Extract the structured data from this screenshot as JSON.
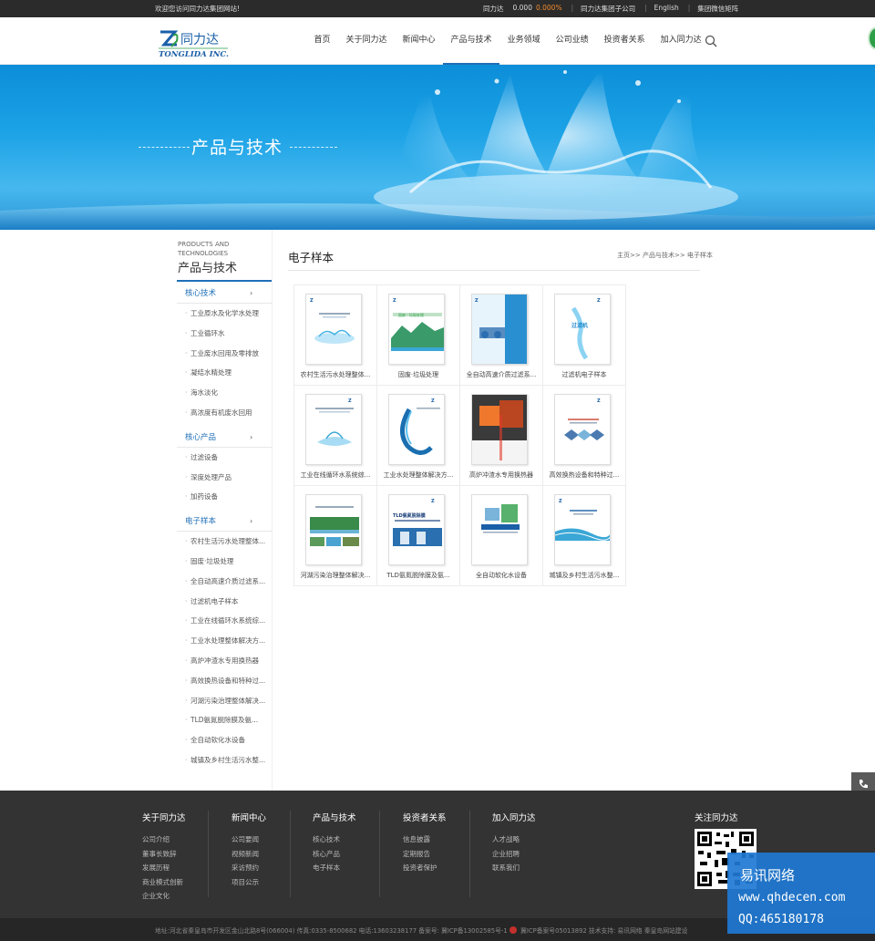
{
  "topbar": {
    "welcome": "欢迎您访问同力达集团网站!",
    "stock_name": "同力达",
    "stock_value": "0.000",
    "stock_change": "0.000%",
    "subsidiaries": "同力达集团子公司",
    "english": "English",
    "wechat": "集团微信矩阵"
  },
  "header": {
    "logo_text": "同力达",
    "logo_sub": "TONGLIDA INC.",
    "nav": [
      "首页",
      "关于同力达",
      "新闻中心",
      "产品与技术",
      "业务领域",
      "公司业绩",
      "投资者关系",
      "加入同力达"
    ],
    "active_nav": "产品与技术"
  },
  "banner": {
    "title": "产品与技术"
  },
  "sidebar": {
    "title_en": "PRODUCTS AND TECHNOLOGIES",
    "title_cn": "产品与技术",
    "categories": [
      {
        "label": "核心技术",
        "items": [
          "工业原水及化学水处理",
          "工业循环水",
          "工业废水回用及零排放",
          "凝结水精处理",
          "海水淡化",
          "高浓度有机废水回用"
        ]
      },
      {
        "label": "核心产品",
        "items": [
          "过滤设备",
          "深度处理产品",
          "加药设备"
        ]
      },
      {
        "label": "电子样本",
        "items": [
          "农村生活污水处理整体...",
          "固废·垃圾处理",
          "全自动高速介质过滤系...",
          "过滤机电子样本",
          "工业在线循环水系统综...",
          "工业水处理整体解决方...",
          "高炉冲渣水专用换热器",
          "高效换热设备和特种过...",
          "河湖污染治理整体解决...",
          "TLD氨氮脱除膜及氨...",
          "全自动软化水设备",
          "城镇及乡村生活污水整..."
        ]
      }
    ],
    "arrow": "›"
  },
  "main": {
    "title": "电子样本",
    "breadcrumb": "主页>> 产品与技术>> 电子样本",
    "cards": [
      "农村生活污水处理整体...",
      "固废·垃圾处理",
      "全自动高速介质过滤系...",
      "过滤机电子样本",
      "工业在线循环水系统综...",
      "工业水处理整体解决方...",
      "高炉冲渣水专用换热器",
      "高效换热设备和特种过...",
      "河湖污染治理整体解决...",
      "TLD氨氮脱除膜及氨...",
      "全自动软化水设备",
      "城镇及乡村生活污水整..."
    ],
    "cover_texts": [
      "",
      "固废 · 垃圾处理",
      "",
      "过滤机",
      "",
      "",
      "",
      "",
      "",
      "TLD氨氮脱除膜",
      "",
      ""
    ]
  },
  "footer": {
    "columns": [
      {
        "title": "关于同力达",
        "items": [
          "公司介绍",
          "董事长致辞",
          "发展历程",
          "商业模式创新",
          "企业文化"
        ]
      },
      {
        "title": "新闻中心",
        "items": [
          "公司要闻",
          "视频新闻",
          "采访预约",
          "项目公示"
        ]
      },
      {
        "title": "产品与技术",
        "items": [
          "核心技术",
          "核心产品",
          "电子样本"
        ]
      },
      {
        "title": "投资者关系",
        "items": [
          "信息披露",
          "定期报告",
          "投资者保护"
        ]
      },
      {
        "title": "加入同力达",
        "items": [
          "人才战略",
          "企业招聘",
          "联系我们"
        ]
      }
    ],
    "follow": "关注同力达",
    "copyright": "地址:河北省秦皇岛市开发区金山北路8号(066004) 传真:0335-8500682 电话:13603238177   备案号: 冀ICP备13002585号-1",
    "copyright2": "冀ICP备案号05013892   技术支持: 易讯网络 秦皇岛网站建设"
  },
  "watermark": {
    "line1": "易讯网络",
    "line2": "www.qhdecen.com",
    "line3": "QQ:465180178"
  },
  "colors": {
    "accent": "#1f6fb7",
    "footer_bg": "#333333",
    "stock_change": "#f08a2c"
  }
}
